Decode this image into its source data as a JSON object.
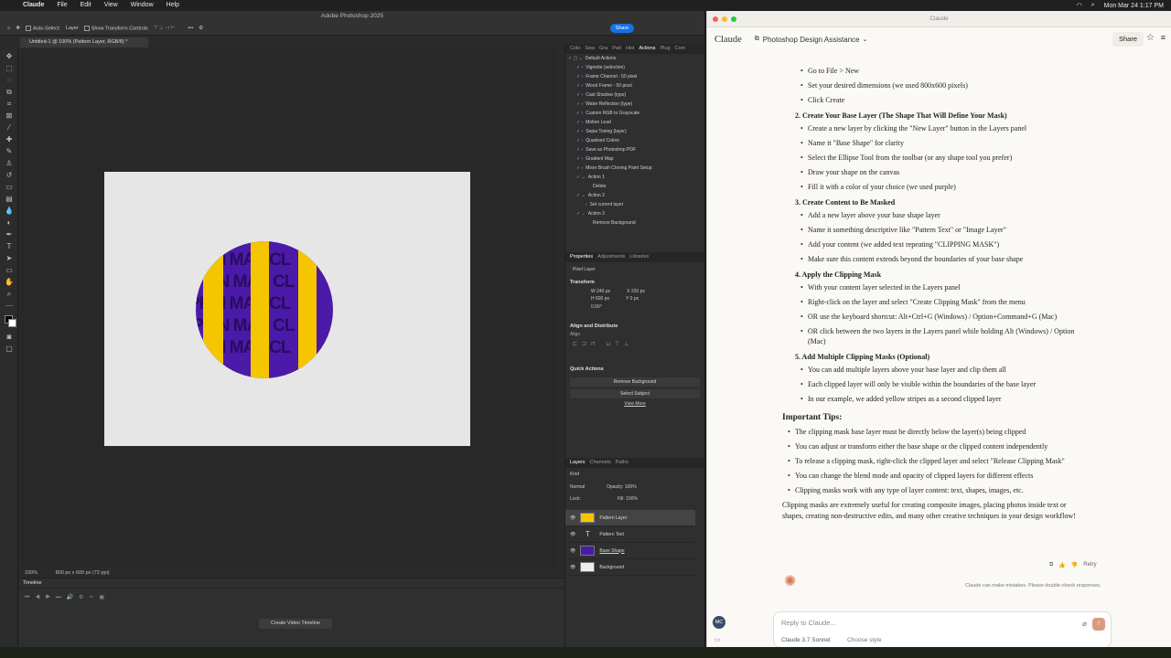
{
  "menubar": {
    "app": "Claude",
    "items": [
      "File",
      "Edit",
      "View",
      "Window",
      "Help"
    ],
    "datetime": "Mon Mar 24  1:17 PM"
  },
  "ps": {
    "title": "Adobe Photoshop 2025",
    "options": {
      "auto_select": "Auto-Select:",
      "layer_select": "Layer",
      "transform": "Show Transform Controls"
    },
    "share": "Share",
    "doc_tab": "Untitled-1 @ 100% (Pattern Layer, RGB/8) *",
    "zoom": "100%",
    "doc_size": "800 px x 600 px (72 ppi)",
    "pattern_words": [
      "PPIN",
      "MAS",
      "CL"
    ],
    "timeline": {
      "title": "Timeline",
      "button": "Create Video Timeline"
    },
    "actions": {
      "tabs": [
        "Colo",
        "Swa",
        "Gra",
        "Patt",
        "Hist",
        "Actions",
        "Plug",
        "Com"
      ],
      "items": [
        "Default Actions",
        "Vignette (selection)",
        "Frame Channel - 50 pixel",
        "Wood Frame - 50 pixel",
        "Cast Shadow (type)",
        "Water Reflection (type)",
        "Custom RGB to Grayscale",
        "Molten Lead",
        "Sepia Toning (layer)",
        "Quadrant Colors",
        "Save as Photoshop PDF",
        "Gradient Map",
        "Mixer Brush Cloning Paint Setup",
        "Action 1",
        "Delete",
        "Action 2",
        "Set current layer",
        "Action 3",
        "Remove Background"
      ]
    },
    "properties": {
      "tabs": [
        "Properties",
        "Adjustments",
        "Libraries"
      ],
      "kind": "Pixel Layer",
      "transform": "Transform",
      "w": "240 px",
      "h": "600 px",
      "x": "220 px",
      "y": "0 px",
      "angle": "0.00°",
      "align": "Align and Distribute",
      "align_label": "Align",
      "quick": "Quick Actions",
      "remove_bg": "Remove Background",
      "select_subject": "Select Subject",
      "view_more": "View More"
    },
    "layers": {
      "tabs": [
        "Layers",
        "Channels",
        "Paths"
      ],
      "kind": "Kind",
      "mode": "Normal",
      "opacity_label": "Opacity:",
      "opacity": "100%",
      "lock": "Lock:",
      "fill_label": "Fill:",
      "fill": "100%",
      "rows": [
        "Pattern Layer",
        "Pattern Text",
        "Base Shape",
        "Background"
      ]
    }
  },
  "claude": {
    "window_title": "Claude",
    "brand": "Claude",
    "project": "Photoshop Design Assistance",
    "share": "Share",
    "step1_bullets": [
      "Go to File > New",
      "Set your desired dimensions (we used 800x600 pixels)",
      "Click Create"
    ],
    "step2": "2.  Create Your Base Layer (The Shape That Will Define Your Mask)",
    "step2_bullets": [
      "Create a new layer by clicking the \"New Layer\" button in the Layers panel",
      "Name it \"Base Shape\" for clarity",
      "Select the Ellipse Tool from the toolbar (or any shape tool you prefer)",
      "Draw your shape on the canvas",
      "Fill it with a color of your choice (we used purple)"
    ],
    "step3": "3.  Create Content to Be Masked",
    "step3_bullets": [
      "Add a new layer above your base shape layer",
      "Name it something descriptive like \"Pattern Text\" or \"Image Layer\"",
      "Add your content (we added text repeating \"CLIPPING MASK\")",
      "Make sure this content extends beyond the boundaries of your base shape"
    ],
    "step4": "4.  Apply the Clipping Mask",
    "step4_bullets": [
      "With your content layer selected in the Layers panel",
      "Right-click on the layer and select \"Create Clipping Mask\" from the menu",
      "OR use the keyboard shortcut: Alt+Ctrl+G (Windows) / Option+Command+G (Mac)",
      "OR click between the two layers in the Layers panel while holding Alt (Windows) / Option (Mac)"
    ],
    "step5": "5.  Add Multiple Clipping Masks (Optional)",
    "step5_bullets": [
      "You can add multiple layers above your base layer and clip them all",
      "Each clipped layer will only be visible within the boundaries of the base layer",
      "In our example, we added yellow stripes as a second clipped layer"
    ],
    "tips_title": "Important Tips:",
    "tips": [
      "The clipping mask base layer must be directly below the layer(s) being clipped",
      "You can adjust or transform either the base shape or the clipped content independently",
      "To release a clipping mask, right-click the clipped layer and select \"Release Clipping Mask\"",
      "You can change the blend mode and opacity of clipped layers for different effects",
      "Clipping masks work with any type of layer content: text, shapes, images, etc."
    ],
    "closing": "Clipping masks are extremely useful for creating composite images, placing photos inside text or shapes, creating non-destructive edits, and many other creative techniques in your design workflow!",
    "retry": "Retry",
    "disclaimer": "Claude can make mistakes. Please double-check responses.",
    "input_placeholder": "Reply to Claude...",
    "model": "Claude 3.7 Sonnet",
    "style": "Choose style",
    "avatar": "MC"
  }
}
